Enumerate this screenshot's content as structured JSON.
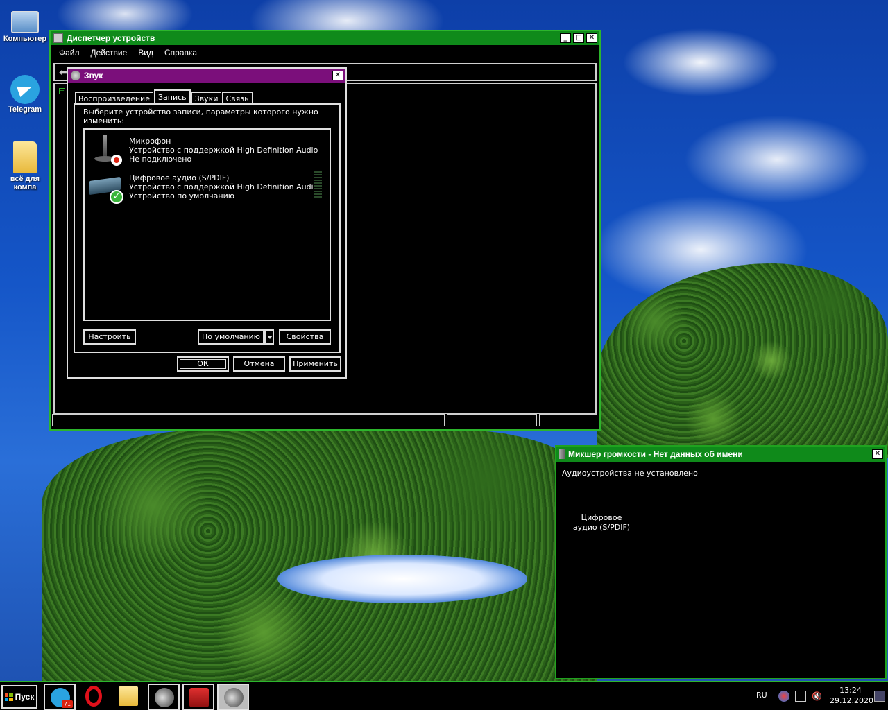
{
  "desktop": {
    "icons": [
      {
        "label": "Компьютер",
        "icon": "computer-icon"
      },
      {
        "label": "Telegram",
        "icon": "telegram-icon"
      },
      {
        "label": "всё для компа",
        "icon": "folder-icon"
      }
    ]
  },
  "device_manager": {
    "title": "Диспетчер устройств",
    "menu": [
      "Файл",
      "Действие",
      "Вид",
      "Справка"
    ],
    "title_buttons": [
      "minimize",
      "maximize",
      "close"
    ]
  },
  "sound_dialog": {
    "title": "Звук",
    "tabs": [
      {
        "label": "Воспроизведение",
        "active": false
      },
      {
        "label": "Запись",
        "active": true
      },
      {
        "label": "Звуки",
        "active": false
      },
      {
        "label": "Связь",
        "active": false
      }
    ],
    "description": "Выберите устройство записи, параметры которого нужно изменить:",
    "devices": [
      {
        "name": "Микрофон",
        "driver": "Устройство с поддержкой High Definition Audio",
        "status": "Не подключено",
        "icon": "microphone-icon",
        "status_icon": "disconnected-badge-icon"
      },
      {
        "name": "Цифровое аудио (S/PDIF)",
        "driver": "Устройство с поддержкой High Definition Audio",
        "status": "Устройство по умолчанию",
        "icon": "spdif-device-icon",
        "status_icon": "default-check-icon"
      }
    ],
    "buttons": {
      "configure": "Настроить",
      "set_default": "По умолчанию",
      "properties": "Свойства",
      "ok": "ОК",
      "cancel": "Отмена",
      "apply": "Применить"
    }
  },
  "mixer": {
    "title": "Микшер громкости - Нет данных об имени",
    "message": "Аудиоустройства не установлено",
    "device_line1": "Цифровое",
    "device_line2": "аудио (S/PDIF)"
  },
  "taskbar": {
    "start_label": "Пуск",
    "apps": [
      {
        "name": "telegram",
        "badge": "71"
      },
      {
        "name": "opera"
      },
      {
        "name": "explorer"
      },
      {
        "name": "sound"
      },
      {
        "name": "toolbox"
      },
      {
        "name": "volume-mixer",
        "active": true
      }
    ],
    "lang": "RU",
    "time": "13:24",
    "date": "29.12.2020"
  },
  "colors": {
    "title_green": "#0f8a1a",
    "title_purple": "#7b0f7b",
    "window_border": "#2cb52c",
    "window_bg": "#000000"
  }
}
